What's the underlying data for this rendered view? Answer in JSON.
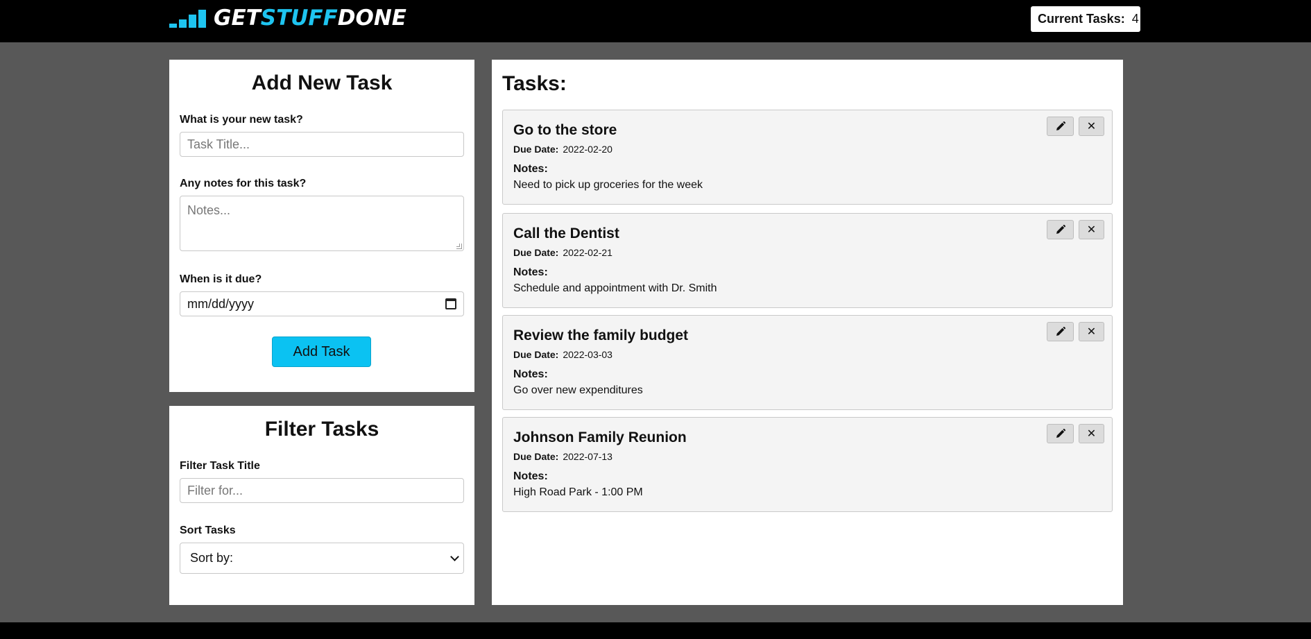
{
  "header": {
    "logo": {
      "part1": "GET",
      "part2": "STUFF",
      "part3": "DONE",
      "accent_color": "#1ec4f0"
    },
    "counter_label": "Current Tasks:",
    "counter_value": "4"
  },
  "add_task": {
    "title": "Add New Task",
    "task_label": "What is your new task?",
    "task_placeholder": "Task Title...",
    "notes_label": "Any notes for this task?",
    "notes_placeholder": "Notes...",
    "due_label": "When is it due?",
    "due_placeholder": "mm/dd/yyyy",
    "submit_label": "Add Task"
  },
  "filter": {
    "title": "Filter Tasks",
    "filter_label": "Filter Task Title",
    "filter_placeholder": "Filter for...",
    "sort_label": "Sort Tasks",
    "sort_selected": "Sort by:"
  },
  "tasks": {
    "title": "Tasks:",
    "due_label": "Due Date:",
    "notes_label": "Notes:",
    "delete_symbol": "✕",
    "items": [
      {
        "name": "Go to the store",
        "due": "2022-02-20",
        "notes": "Need to pick up groceries for the week"
      },
      {
        "name": "Call the Dentist",
        "due": "2022-02-21",
        "notes": "Schedule and appointment with Dr. Smith"
      },
      {
        "name": "Review the family budget",
        "due": "2022-03-03",
        "notes": "Go over new expenditures"
      },
      {
        "name": "Johnson Family Reunion",
        "due": "2022-07-13",
        "notes": "High Road Park - 1:00 PM"
      }
    ]
  }
}
